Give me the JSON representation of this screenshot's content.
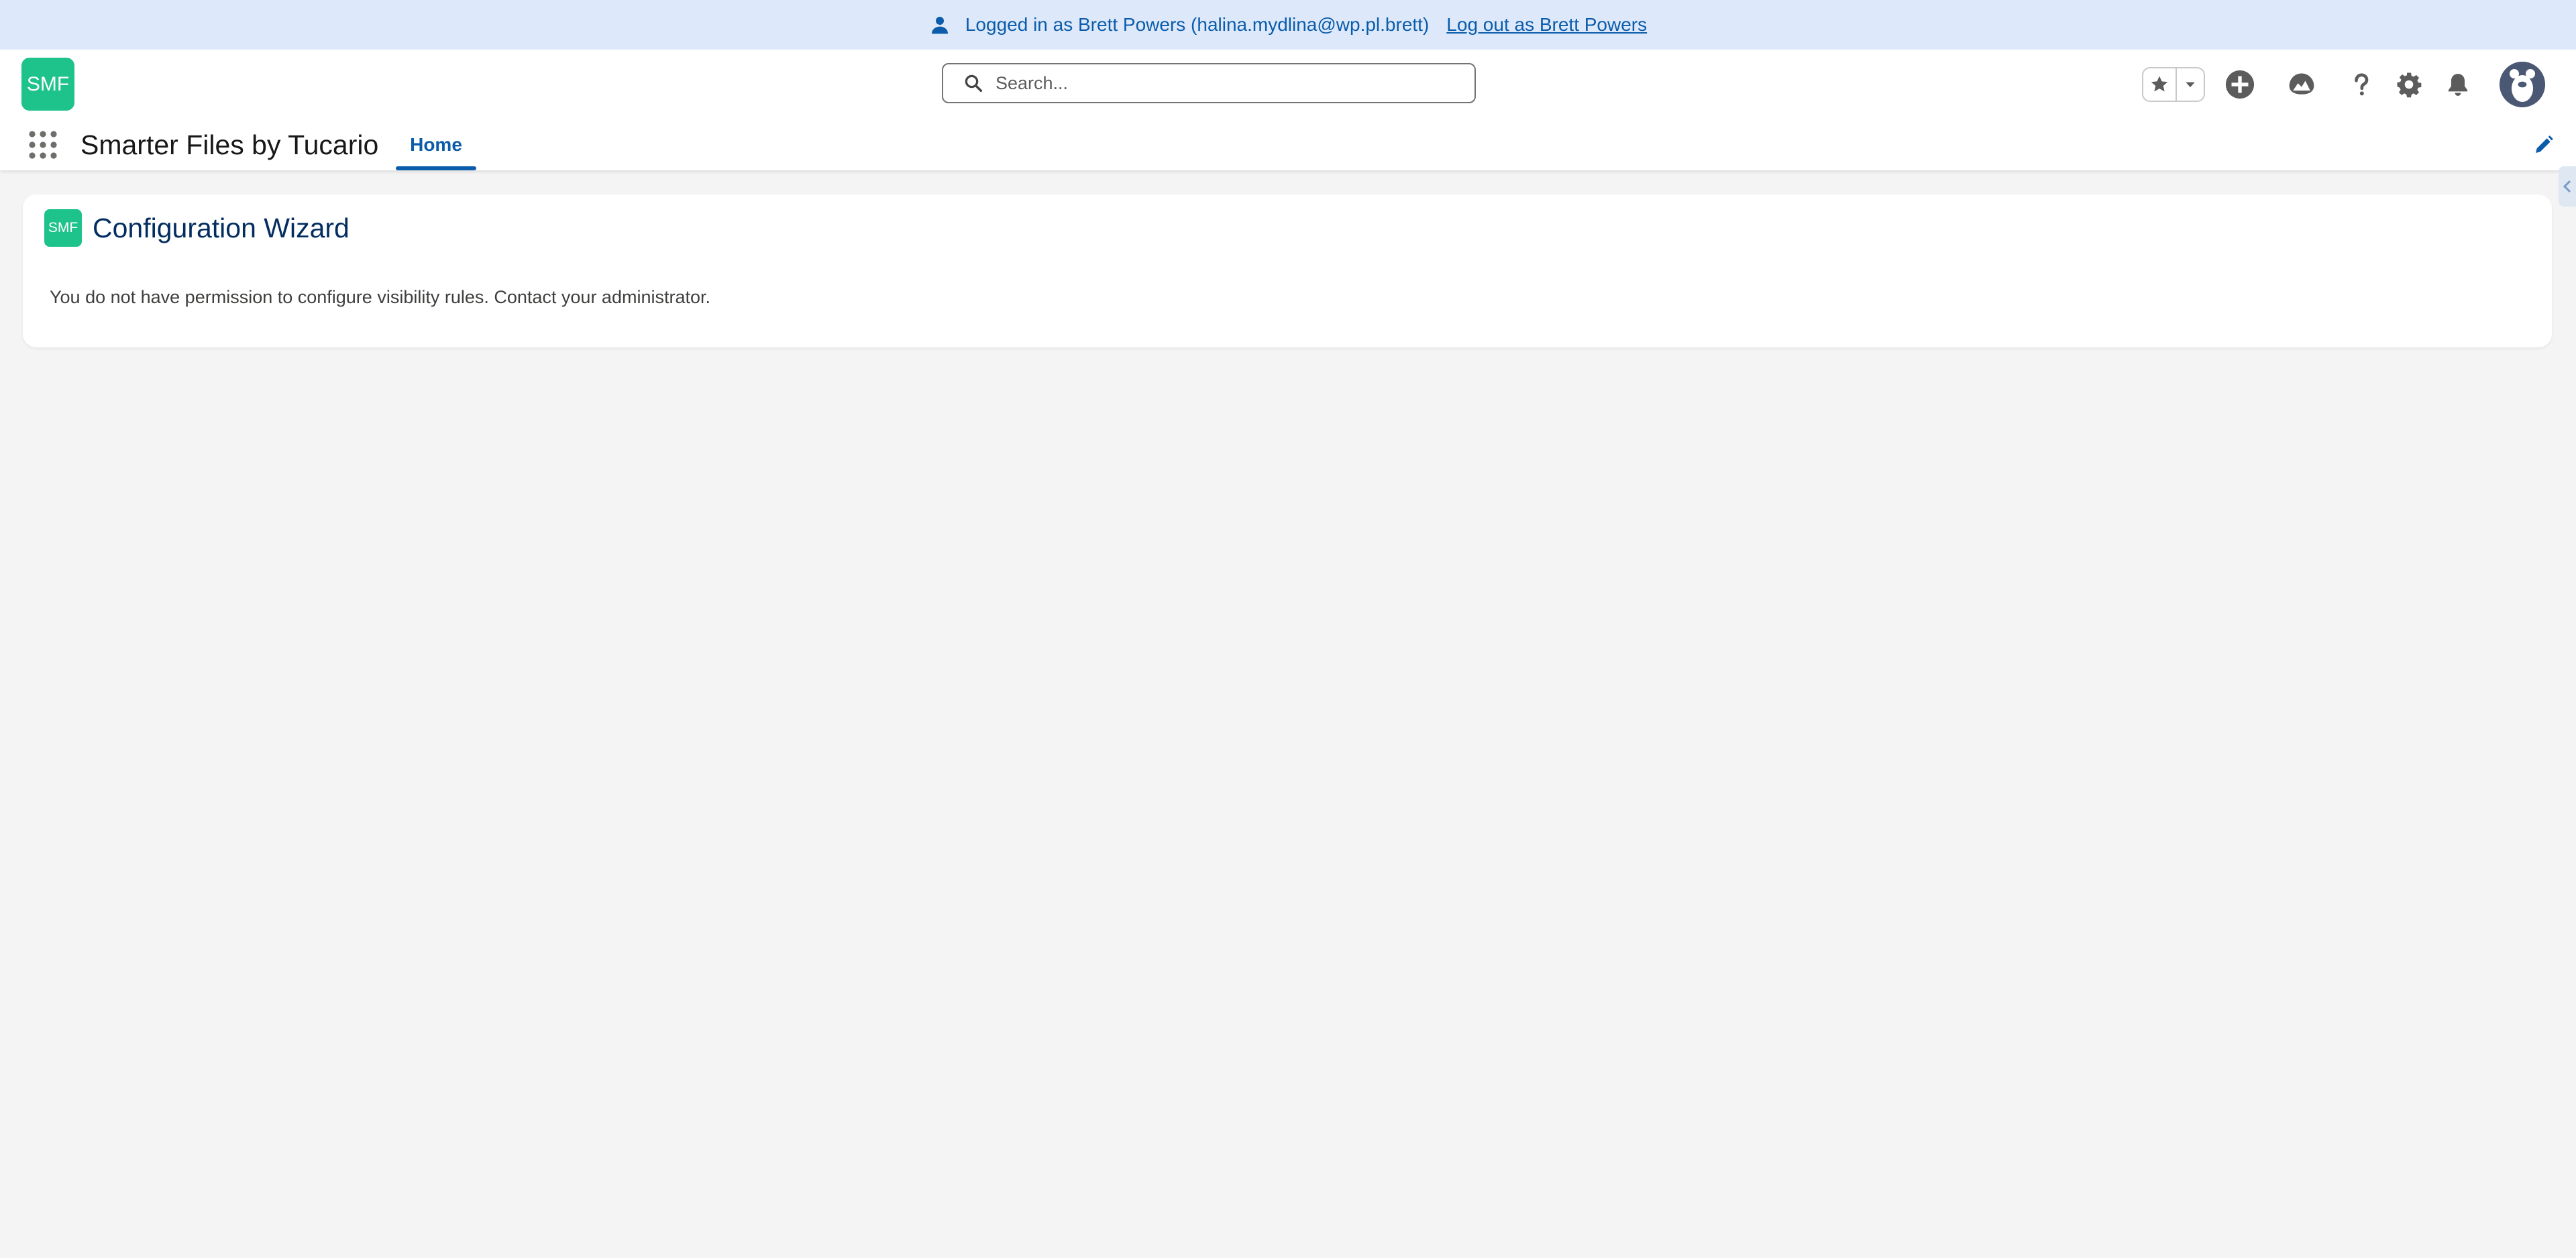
{
  "banner": {
    "logged_in_text": "Logged in as Brett Powers (halina.mydlina@wp.pl.brett)",
    "logout_label": "Log out as Brett Powers"
  },
  "header": {
    "logo_text": "SMF",
    "search_placeholder": "Search...",
    "icons": [
      "star-icon",
      "chevron-down-icon",
      "add-icon",
      "trailhead-icon",
      "help-icon",
      "gear-icon",
      "bell-icon",
      "avatar"
    ]
  },
  "nav": {
    "app_name": "Smarter Files by Tucario",
    "tabs": [
      {
        "label": "Home",
        "active": true
      }
    ]
  },
  "card": {
    "icon_text": "SMF",
    "title": "Configuration Wizard",
    "message": "You do not have permission to configure visibility rules. Contact your administrator."
  },
  "colors": {
    "brand_green": "#1ec28b",
    "link_blue": "#0b5cab",
    "banner_bg": "#dde9fa",
    "title_navy": "#032d60",
    "page_bg": "#f4f4f4"
  }
}
